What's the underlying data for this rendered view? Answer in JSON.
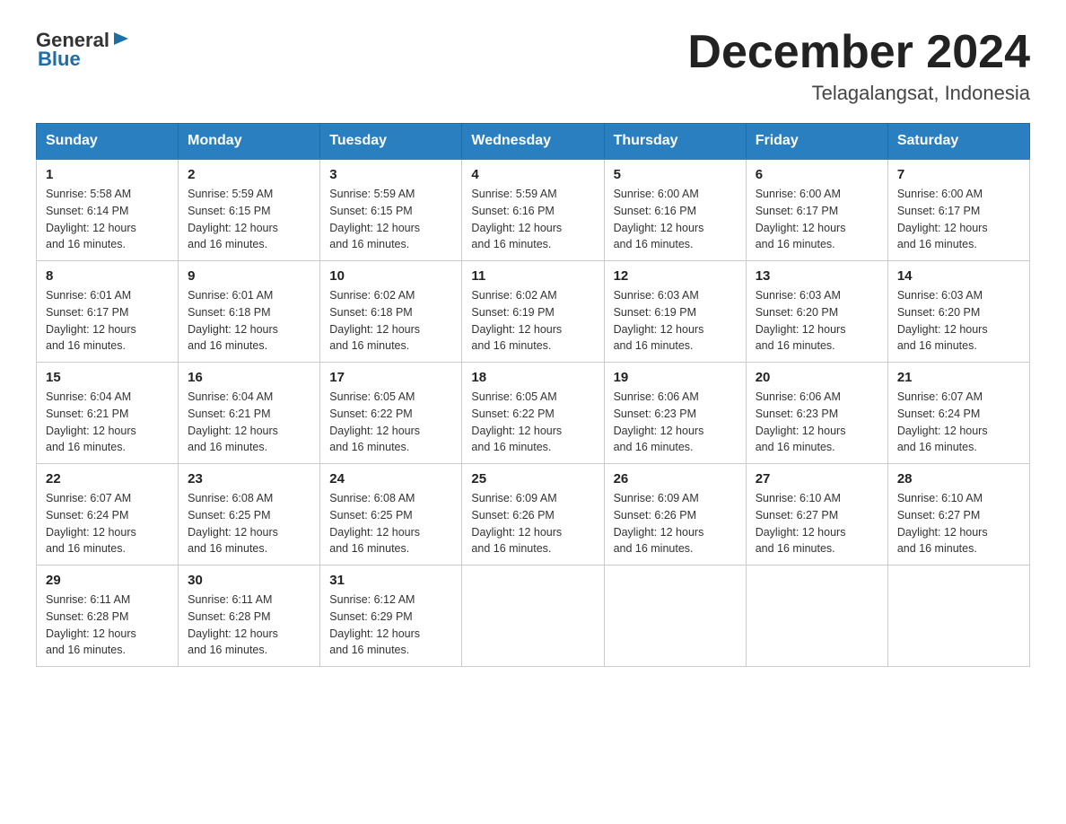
{
  "header": {
    "logo_general": "General",
    "logo_blue": "Blue",
    "month_title": "December 2024",
    "location": "Telagalangsat, Indonesia"
  },
  "columns": [
    "Sunday",
    "Monday",
    "Tuesday",
    "Wednesday",
    "Thursday",
    "Friday",
    "Saturday"
  ],
  "weeks": [
    [
      {
        "day": "1",
        "sunrise": "5:58 AM",
        "sunset": "6:14 PM",
        "daylight": "12 hours and 16 minutes."
      },
      {
        "day": "2",
        "sunrise": "5:59 AM",
        "sunset": "6:15 PM",
        "daylight": "12 hours and 16 minutes."
      },
      {
        "day": "3",
        "sunrise": "5:59 AM",
        "sunset": "6:15 PM",
        "daylight": "12 hours and 16 minutes."
      },
      {
        "day": "4",
        "sunrise": "5:59 AM",
        "sunset": "6:16 PM",
        "daylight": "12 hours and 16 minutes."
      },
      {
        "day": "5",
        "sunrise": "6:00 AM",
        "sunset": "6:16 PM",
        "daylight": "12 hours and 16 minutes."
      },
      {
        "day": "6",
        "sunrise": "6:00 AM",
        "sunset": "6:17 PM",
        "daylight": "12 hours and 16 minutes."
      },
      {
        "day": "7",
        "sunrise": "6:00 AM",
        "sunset": "6:17 PM",
        "daylight": "12 hours and 16 minutes."
      }
    ],
    [
      {
        "day": "8",
        "sunrise": "6:01 AM",
        "sunset": "6:17 PM",
        "daylight": "12 hours and 16 minutes."
      },
      {
        "day": "9",
        "sunrise": "6:01 AM",
        "sunset": "6:18 PM",
        "daylight": "12 hours and 16 minutes."
      },
      {
        "day": "10",
        "sunrise": "6:02 AM",
        "sunset": "6:18 PM",
        "daylight": "12 hours and 16 minutes."
      },
      {
        "day": "11",
        "sunrise": "6:02 AM",
        "sunset": "6:19 PM",
        "daylight": "12 hours and 16 minutes."
      },
      {
        "day": "12",
        "sunrise": "6:03 AM",
        "sunset": "6:19 PM",
        "daylight": "12 hours and 16 minutes."
      },
      {
        "day": "13",
        "sunrise": "6:03 AM",
        "sunset": "6:20 PM",
        "daylight": "12 hours and 16 minutes."
      },
      {
        "day": "14",
        "sunrise": "6:03 AM",
        "sunset": "6:20 PM",
        "daylight": "12 hours and 16 minutes."
      }
    ],
    [
      {
        "day": "15",
        "sunrise": "6:04 AM",
        "sunset": "6:21 PM",
        "daylight": "12 hours and 16 minutes."
      },
      {
        "day": "16",
        "sunrise": "6:04 AM",
        "sunset": "6:21 PM",
        "daylight": "12 hours and 16 minutes."
      },
      {
        "day": "17",
        "sunrise": "6:05 AM",
        "sunset": "6:22 PM",
        "daylight": "12 hours and 16 minutes."
      },
      {
        "day": "18",
        "sunrise": "6:05 AM",
        "sunset": "6:22 PM",
        "daylight": "12 hours and 16 minutes."
      },
      {
        "day": "19",
        "sunrise": "6:06 AM",
        "sunset": "6:23 PM",
        "daylight": "12 hours and 16 minutes."
      },
      {
        "day": "20",
        "sunrise": "6:06 AM",
        "sunset": "6:23 PM",
        "daylight": "12 hours and 16 minutes."
      },
      {
        "day": "21",
        "sunrise": "6:07 AM",
        "sunset": "6:24 PM",
        "daylight": "12 hours and 16 minutes."
      }
    ],
    [
      {
        "day": "22",
        "sunrise": "6:07 AM",
        "sunset": "6:24 PM",
        "daylight": "12 hours and 16 minutes."
      },
      {
        "day": "23",
        "sunrise": "6:08 AM",
        "sunset": "6:25 PM",
        "daylight": "12 hours and 16 minutes."
      },
      {
        "day": "24",
        "sunrise": "6:08 AM",
        "sunset": "6:25 PM",
        "daylight": "12 hours and 16 minutes."
      },
      {
        "day": "25",
        "sunrise": "6:09 AM",
        "sunset": "6:26 PM",
        "daylight": "12 hours and 16 minutes."
      },
      {
        "day": "26",
        "sunrise": "6:09 AM",
        "sunset": "6:26 PM",
        "daylight": "12 hours and 16 minutes."
      },
      {
        "day": "27",
        "sunrise": "6:10 AM",
        "sunset": "6:27 PM",
        "daylight": "12 hours and 16 minutes."
      },
      {
        "day": "28",
        "sunrise": "6:10 AM",
        "sunset": "6:27 PM",
        "daylight": "12 hours and 16 minutes."
      }
    ],
    [
      {
        "day": "29",
        "sunrise": "6:11 AM",
        "sunset": "6:28 PM",
        "daylight": "12 hours and 16 minutes."
      },
      {
        "day": "30",
        "sunrise": "6:11 AM",
        "sunset": "6:28 PM",
        "daylight": "12 hours and 16 minutes."
      },
      {
        "day": "31",
        "sunrise": "6:12 AM",
        "sunset": "6:29 PM",
        "daylight": "12 hours and 16 minutes."
      },
      null,
      null,
      null,
      null
    ]
  ],
  "labels": {
    "sunrise": "Sunrise:",
    "sunset": "Sunset:",
    "daylight": "Daylight:"
  }
}
